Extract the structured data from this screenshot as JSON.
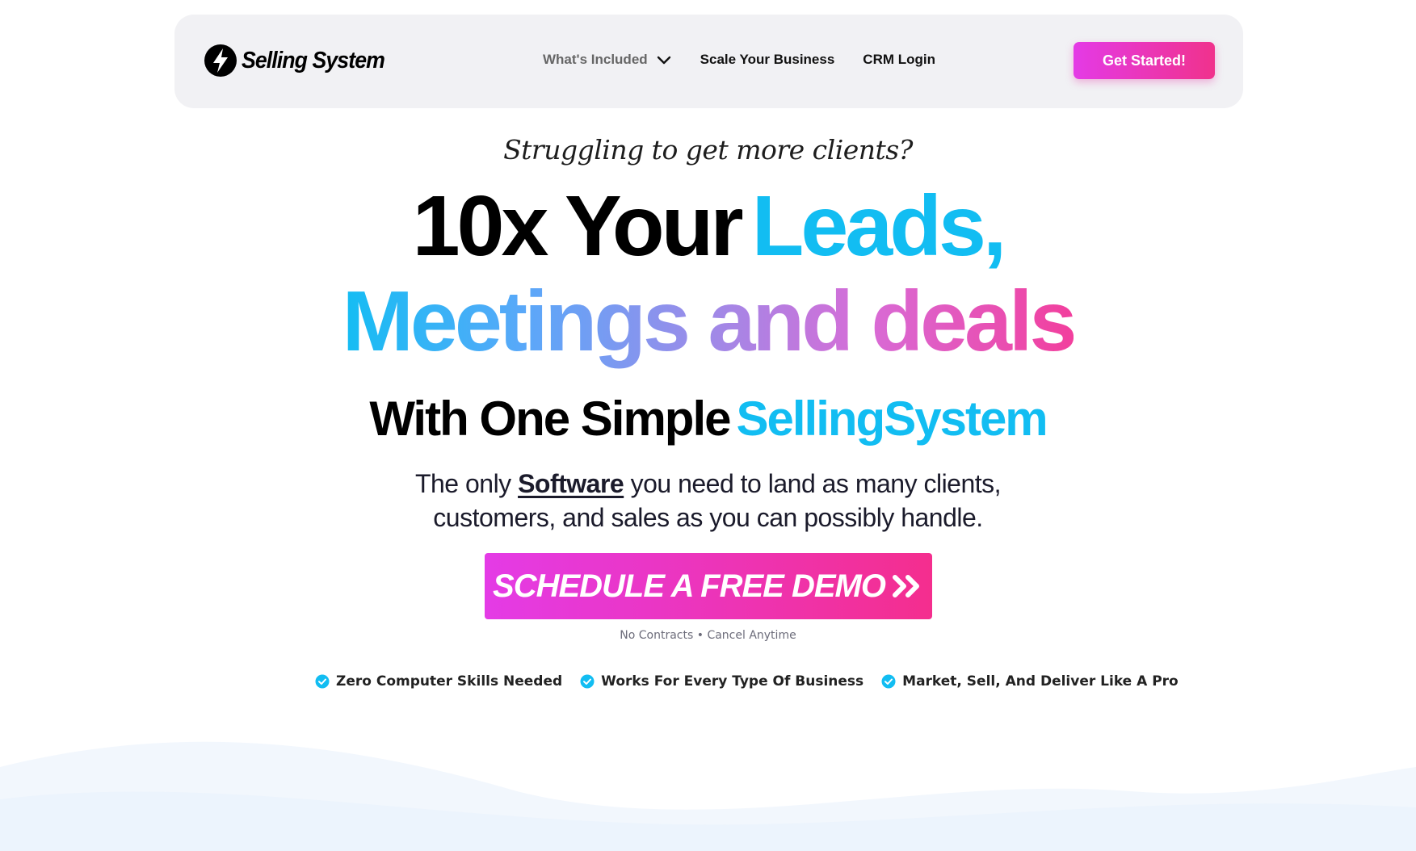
{
  "nav": {
    "logo_text": "Selling System",
    "whats_included": "What's Included",
    "scale_business": "Scale Your Business",
    "crm_login": "CRM Login",
    "cta": "Get Started!"
  },
  "hero": {
    "tagline": "Struggling to get more clients?",
    "headline_part1": "10x Your",
    "headline_part2": "Leads,",
    "headline_line2": "Meetings and deals",
    "subheadline_part1": "With One Simple",
    "subheadline_part2": "SellingSystem",
    "description_before": "The only ",
    "description_link": "Software",
    "description_after": " you need to land as many clients,",
    "description_line2": "customers, and sales as you can possibly handle.",
    "demo_button": "SCHEDULE A FREE DEMO",
    "demo_note": "No Contracts • Cancel Anytime"
  },
  "features": [
    "Zero Computer Skills Needed",
    "Works For Every Type Of Business",
    "Market, Sell, And Deliver Like A Pro"
  ],
  "colors": {
    "accent_blue": "#12bdf2",
    "accent_pink": "#f0328c",
    "accent_magenta": "#e43ae6",
    "nav_bg": "#f1f1f4"
  },
  "icons": {
    "logo": "lightning-bolt-icon",
    "dropdown": "chevron-down-icon",
    "demo_arrow": "double-chevron-right-icon",
    "feature_check": "check-circle-icon"
  }
}
